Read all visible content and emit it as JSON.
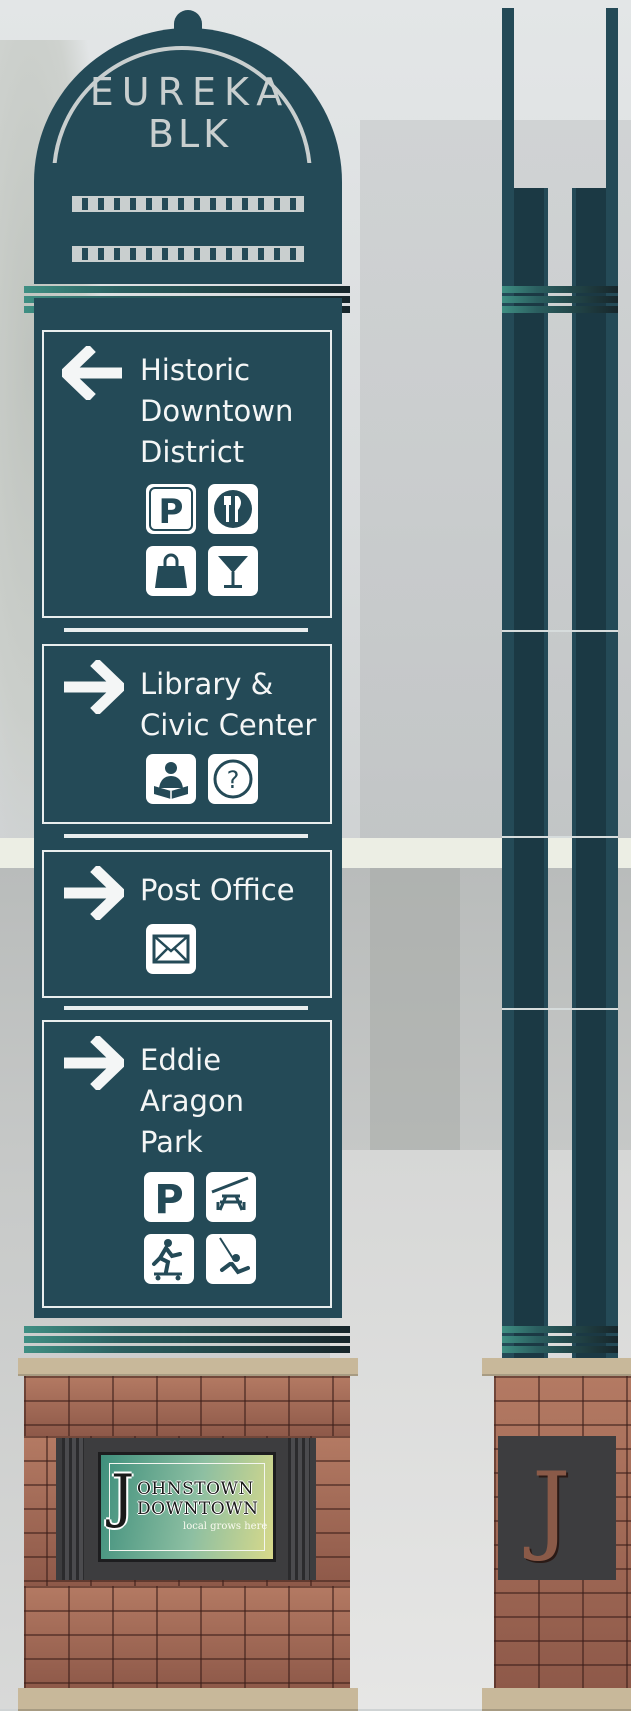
{
  "header": {
    "line1": "EUREKA",
    "line2": "BLK"
  },
  "panels": [
    {
      "arrow": "arrow-left",
      "title_lines": [
        "Historic",
        "Downtown",
        "District"
      ],
      "icons": [
        "parking-icon",
        "dining-icon",
        "shopping-bag-icon",
        "cocktail-icon"
      ]
    },
    {
      "arrow": "arrow-right",
      "title_lines": [
        "Library &",
        "Civic Center"
      ],
      "icons": [
        "library-reader-icon",
        "information-question-icon"
      ]
    },
    {
      "arrow": "arrow-right",
      "title_lines": [
        "Post Office"
      ],
      "icons": [
        "mail-envelope-icon"
      ]
    },
    {
      "arrow": "arrow-right",
      "title_lines": [
        "Eddie",
        "Aragon",
        "Park"
      ],
      "icons": [
        "parking-icon",
        "picnic-table-icon",
        "skateboard-icon",
        "swing-icon"
      ]
    }
  ],
  "plaque": {
    "logo_initial": "J",
    "line1": "OHNSTOWN",
    "line2": "DOWNTOWN",
    "tagline": "local grows here"
  },
  "side_view": {
    "plaque_initial": "J"
  },
  "colors": {
    "sign_teal": "#244a57",
    "panel_border": "#e8eeee",
    "accent_teal": "#3f8f83",
    "brick": "#9c6553",
    "cap_stone": "#c8b89a"
  }
}
